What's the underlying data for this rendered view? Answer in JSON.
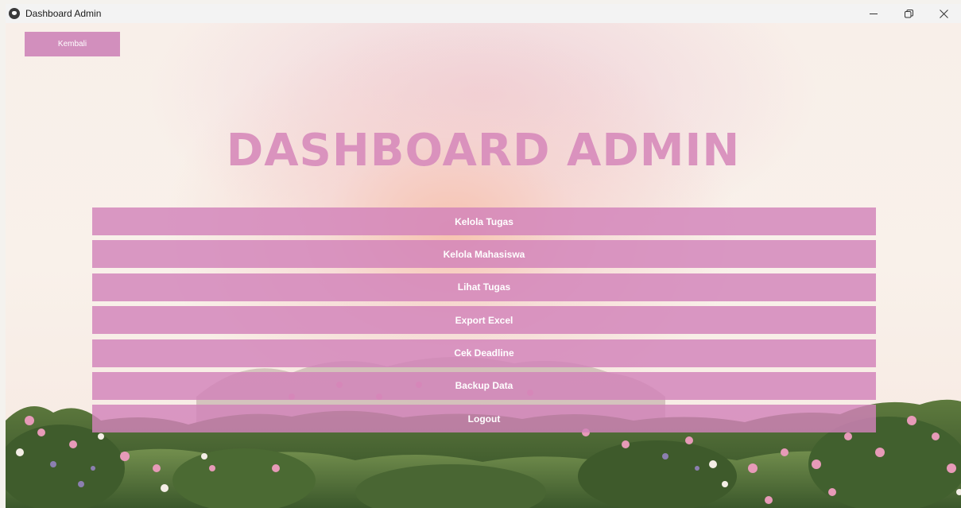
{
  "window": {
    "title": "Dashboard Admin"
  },
  "header": {
    "back_label": "Kembali",
    "page_title": "DASHBOARD ADMIN"
  },
  "menu": {
    "items": [
      {
        "label": "Kelola Tugas"
      },
      {
        "label": "Kelola Mahasiswa"
      },
      {
        "label": "Lihat Tugas"
      },
      {
        "label": "Export Excel"
      },
      {
        "label": "Cek Deadline"
      },
      {
        "label": "Backup Data"
      },
      {
        "label": "Logout"
      }
    ]
  },
  "colors": {
    "accent": "#d28fbd",
    "title": "#d88dbc",
    "button_text": "#ffffff"
  },
  "icons": {
    "app": "app-icon",
    "minimize": "minimize-icon",
    "restore": "restore-icon",
    "close": "close-icon"
  }
}
